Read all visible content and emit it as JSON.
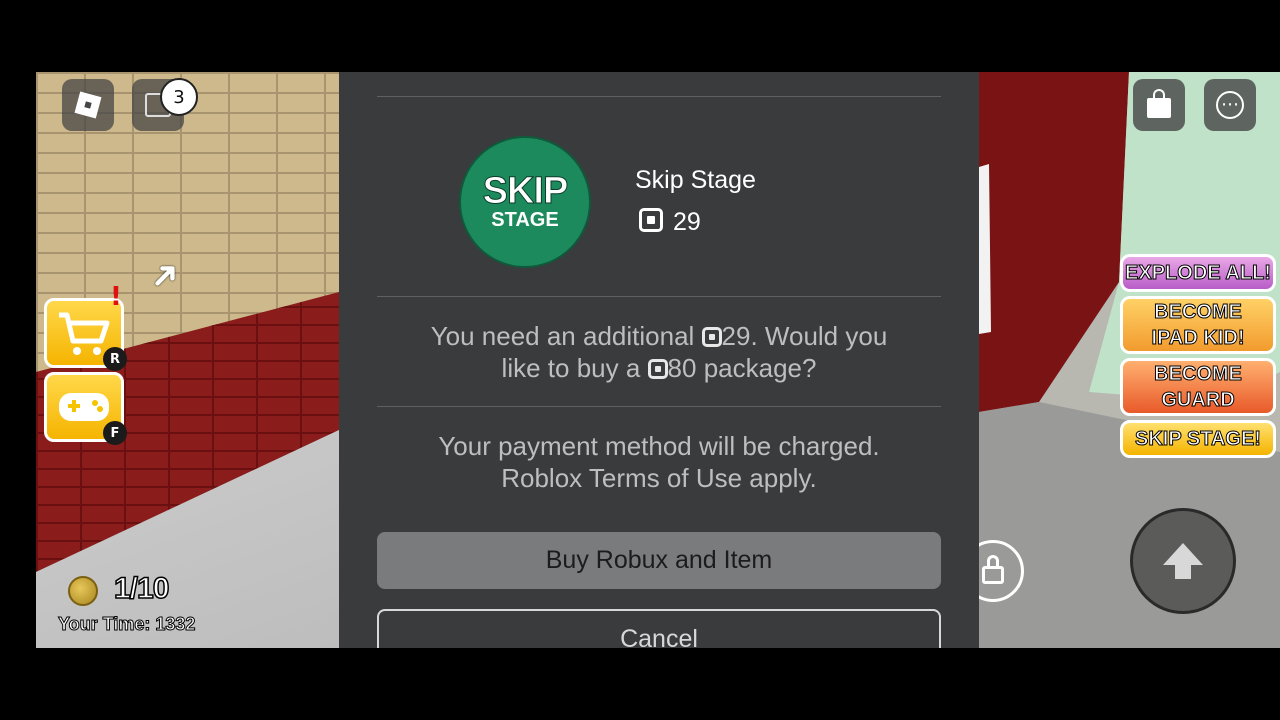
{
  "topbar": {
    "chat_badge": "3"
  },
  "hud": {
    "stage_progress": "1/10",
    "timer": "Your Time: 1332",
    "key_shop": "R",
    "key_games": "F"
  },
  "side_buttons": {
    "explode": "EXPLODE ALL!",
    "ipad_line1": "BECOME",
    "ipad_line2": "IPAD KID!",
    "guard_line1": "BECOME",
    "guard_line2": "GUARD",
    "skip": "SKIP STAGE!"
  },
  "purchase": {
    "icon_text_1": "SKIP",
    "icon_text_2": "STAGE",
    "item_name": "Skip Stage",
    "price": "29",
    "msg1_a": "You need an additional",
    "msg1_b": "29. Would you",
    "msg1_c": "like to buy a",
    "msg1_d": "80",
    "msg1_e": "package?",
    "msg2_a": "Your payment method will be charged.",
    "msg2_b": "Roblox Terms of Use apply.",
    "buy_label": "Buy Robux and Item",
    "cancel_label": "Cancel"
  },
  "colors": {
    "dialog_bg": "#393b3d",
    "icon_green": "#1d8a5e",
    "button_gray": "#7a7b7c"
  }
}
